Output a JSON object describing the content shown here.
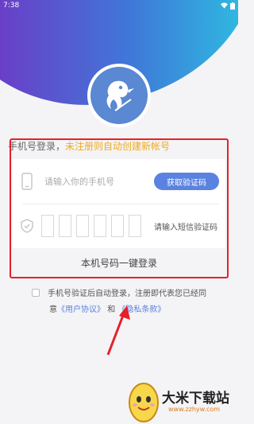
{
  "status_bar": {
    "time": "7:38"
  },
  "login": {
    "prompt_prefix": "手机号登录，",
    "prompt_highlight": "未注册则自动创建新帐号",
    "phone_placeholder": "请输入你的手机号",
    "get_code_label": "获取验证码",
    "code_hint": "请输入短信验证码",
    "one_click_label": "本机号码一键登录"
  },
  "agreement": {
    "line1": "手机号验证后自动登录，注册即代表您已经同",
    "line2_prefix": "意",
    "user_agreement": "《用户协议》",
    "and": "和",
    "privacy_terms": "《隐私条款》"
  },
  "watermark": {
    "title": "大米下载站",
    "url": "www.zzhyw.com"
  },
  "colors": {
    "accent": "#5a82e0",
    "highlight": "#f0ab1a",
    "annotation": "#e5202a"
  },
  "icons": [
    "wifi-icon",
    "battery-icon",
    "logo-bird-icon",
    "phone-icon",
    "shield-check-icon",
    "checkbox-icon",
    "arrow-annotation-icon",
    "egg-mascot-icon"
  ]
}
